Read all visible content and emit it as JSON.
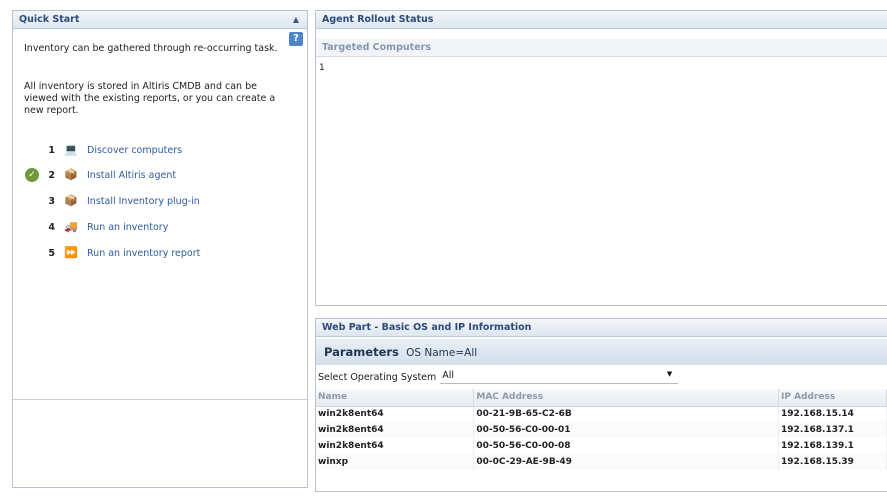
{
  "quick_start": {
    "title": "Quick Start",
    "help_label": "?",
    "intro_1": "Inventory can be gathered through re-occurring task.",
    "intro_2": "All inventory is stored in Altiris CMDB and can be viewed with the existing reports, or you can create a new report.",
    "steps": [
      {
        "num": "1",
        "label": "Discover computers",
        "icon": "computer-discover-icon",
        "done": false
      },
      {
        "num": "2",
        "label": "Install Altiris agent",
        "icon": "package-install-icon",
        "done": true
      },
      {
        "num": "3",
        "label": "Install Inventory plug-in",
        "icon": "package-install-icon",
        "done": false
      },
      {
        "num": "4",
        "label": "Run an inventory",
        "icon": "inventory-run-icon",
        "done": false
      },
      {
        "num": "5",
        "label": "Run an inventory report",
        "icon": "report-arrow-icon",
        "done": false
      }
    ]
  },
  "agent_rollout": {
    "title": "Agent Rollout Status",
    "subtitle": "Targeted Computers",
    "value": "1"
  },
  "web_part": {
    "title": "Web Part - Basic OS and IP Information",
    "parameters_label": "Parameters",
    "parameters_value": "OS Name=All",
    "os_select_label": "Select Operating System",
    "os_select_value": "All",
    "columns": [
      "Name",
      "MAC Address",
      "IP Address"
    ],
    "rows": [
      [
        "win2k8ent64",
        "00-21-9B-65-C2-6B",
        "192.168.15.14"
      ],
      [
        "win2k8ent64",
        "00-50-56-C0-00-01",
        "192.168.137.1"
      ],
      [
        "win2k8ent64",
        "00-50-56-C0-00-08",
        "192.168.139.1"
      ],
      [
        "winxp",
        "00-0C-29-AE-9B-49",
        "192.168.15.39"
      ]
    ]
  },
  "colors": {
    "header_text": "#2b4a7a",
    "link": "#2f5b9c",
    "check_green": "#6e9a3c"
  }
}
